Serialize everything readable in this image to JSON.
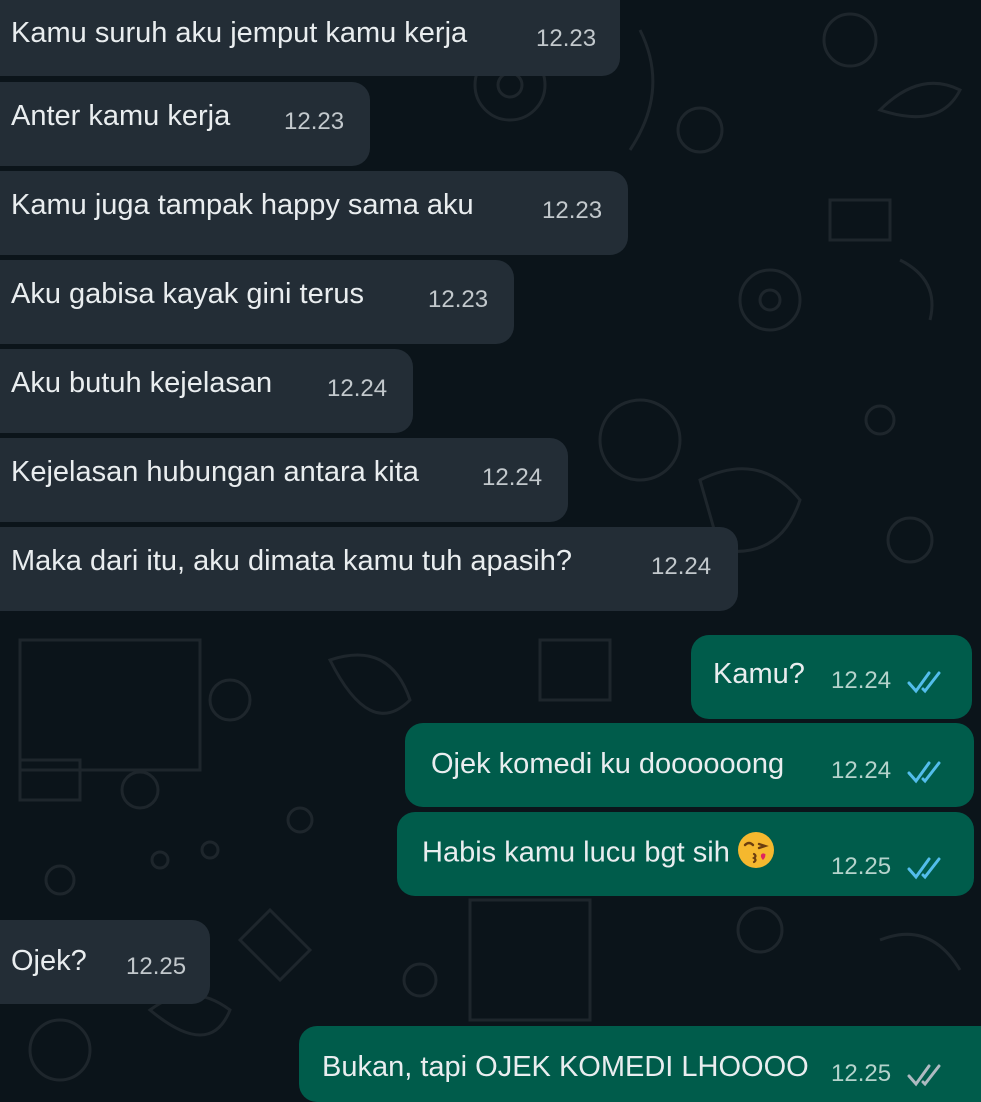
{
  "colors": {
    "background": "#0b141a",
    "incoming_bubble": "#232d36",
    "outgoing_bubble": "#005c4b",
    "read_ticks": "#53bdeb",
    "delivered_ticks": "#aebac1"
  },
  "messages": [
    {
      "direction": "incoming",
      "text": "Kamu suruh aku jemput kamu kerja",
      "time": "12.23"
    },
    {
      "direction": "incoming",
      "text": "Anter kamu kerja",
      "time": "12.23"
    },
    {
      "direction": "incoming",
      "text": "Kamu juga tampak happy sama aku",
      "time": "12.23"
    },
    {
      "direction": "incoming",
      "text": "Aku gabisa kayak gini terus",
      "time": "12.23"
    },
    {
      "direction": "incoming",
      "text": "Aku butuh kejelasan",
      "time": "12.24"
    },
    {
      "direction": "incoming",
      "text": "Kejelasan hubungan antara kita",
      "time": "12.24"
    },
    {
      "direction": "incoming",
      "text": "Maka dari itu, aku dimata kamu tuh apasih?",
      "time": "12.24"
    },
    {
      "direction": "outgoing",
      "text": "Kamu?",
      "time": "12.24",
      "status": "read"
    },
    {
      "direction": "outgoing",
      "text": "Ojek komedi ku doooooong",
      "time": "12.24",
      "status": "read"
    },
    {
      "direction": "outgoing",
      "text": "Habis kamu lucu bgt sih",
      "time": "12.25",
      "status": "read",
      "emoji": "face-blowing-a-kiss"
    },
    {
      "direction": "incoming",
      "text": "Ojek?",
      "time": "12.25"
    },
    {
      "direction": "outgoing",
      "text": "Bukan, tapi OJEK KOMEDI LHOOOO",
      "time": "12.25",
      "status": "delivered"
    }
  ]
}
